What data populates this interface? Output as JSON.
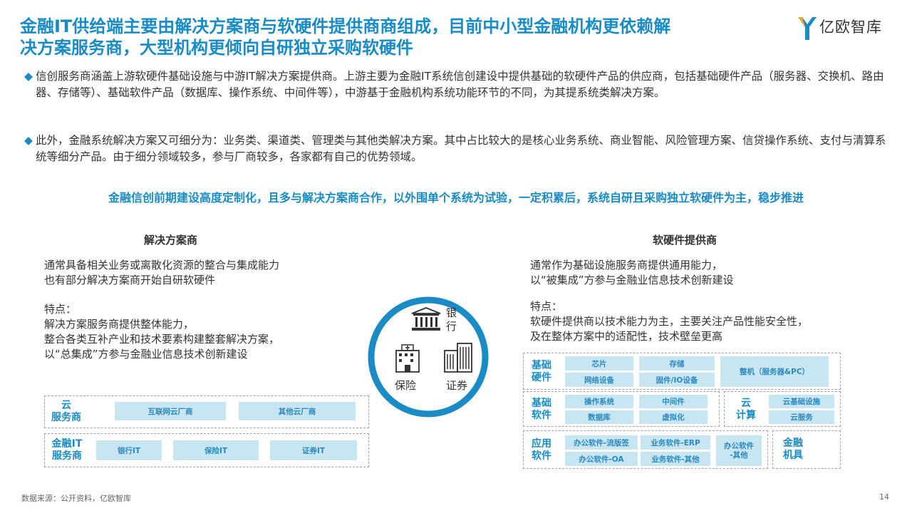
{
  "header": {
    "title_line1": "金融IT供给端主要由解决方案商与软硬件提供商商组成，目前中小型金融机构更依赖解",
    "title_line2": "决方案服务商，大型机构更倾向自研独立采购软硬件",
    "logo_text": "亿欧智库"
  },
  "paragraphs": [
    {
      "bullet": "◆",
      "text": "信创服务商涵盖上游软硬件基础设施与中游IT解决方案提供商。上游主要为金融IT系统信创建设中提供基础的软硬件产品的供应商，包括基础硬件产品（服务器、交换机、路由器、存储等）、基础软件产品（数据库、操作系统、中间件等），中游基于金融机构系统功能环节的不同，为其提系统类解决方案。"
    },
    {
      "bullet": "◆",
      "text": "此外，金融系统解决方案又可细分为：业务类、渠道类、管理类与其他类解决方案。其中占比较大的是核心业务系统、商业智能、风险管理方案、信贷操作系统、支付与清算系统等细分产品。由于细分领域较多，参与厂商较多，各家都有自己的优势领域。"
    }
  ],
  "highlight": "金融信创前期建设高度定制化，且多与解决方案商合作，以外围单个系统为试验，一定积累后，系统自研且采购独立软硬件为主，稳步推进",
  "left": {
    "title": "解决方案商",
    "desc1": "通常具备相关业务或离散化资源的整合与集成能力",
    "desc2": "也有部分解决方案商开始自研软硬件",
    "feat_title": "特点：",
    "feat1": "解决方案服务商提供整体能力，",
    "feat2": "整合各类互补产业和技术要素构建整套解决方案，",
    "feat3": "以“总集成”方参与金融业信息技术创新建设",
    "cloud_label": "云\n服务商",
    "cloud_items": [
      "互联网云厂商",
      "其他云厂商"
    ],
    "fin_label": "金融IT\n服务商",
    "fin_items": [
      "银行IT",
      "保险IT",
      "证券IT"
    ]
  },
  "circle": {
    "bank": "银\n行",
    "insurance": "保险",
    "securities": "证券"
  },
  "right": {
    "title": "软硬件提供商",
    "desc1": "通常作为基础设施服务商提供通用能力，",
    "desc2": "以“被集成”方参与金融业信息技术创新建设",
    "feat_title": "特点：",
    "feat1": "软硬件提供商以技术能力为主，主要关注产品性能安全性，",
    "feat2": "及在整体方案中的适配性，技术壁垒更高",
    "hw_label": "基础\n硬件",
    "hw_items": [
      "芯片",
      "存储",
      "网络设备",
      "固件/IO设备"
    ],
    "hw_big": "整机（服务器&PC）",
    "sw_label": "基础\n软件",
    "sw_items": [
      "操作系统",
      "中间件",
      "数据库",
      "虚拟化"
    ],
    "cloud_label": "云\n计算",
    "cloud_items": [
      "云基础设施",
      "云服务"
    ],
    "app_label": "应用\n软件",
    "app_items": [
      "办公软件-流版签",
      "业务软件-ERP",
      "办公软件-OA",
      "业务软件-其他"
    ],
    "app_other": "办公软件\n-其他",
    "fin_tool_label": "金融\n机具"
  },
  "footer": {
    "source": "数据来源：公开资料，亿欧智库",
    "page": "14"
  },
  "colors": {
    "accent": "#1a8bc4",
    "pill_bg": "#c8e5f2",
    "circle_ring": "#1a8bc4"
  }
}
